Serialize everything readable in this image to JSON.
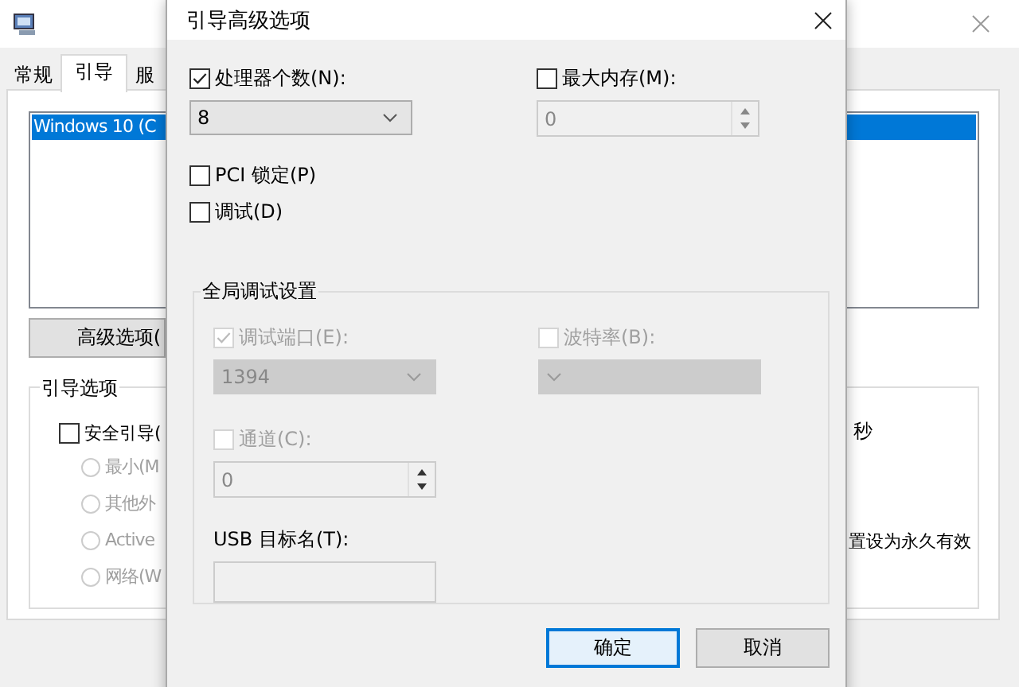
{
  "main_window": {
    "tabs": [
      {
        "label": "常规",
        "selected": false
      },
      {
        "label": "引导",
        "selected": true
      },
      {
        "label": "服",
        "selected": false
      }
    ],
    "boot_list": [
      {
        "label": "Windows 10 (C",
        "selected": true
      }
    ],
    "advanced_button": "高级选项(",
    "boot_options": {
      "title": "引导选项",
      "safe_boot": {
        "label": "安全引导(",
        "checked": false
      },
      "modes": [
        {
          "label": "最小(M",
          "selected": false,
          "disabled": true
        },
        {
          "label": "其他外",
          "selected": false,
          "disabled": true
        },
        {
          "label": "Active",
          "selected": false,
          "disabled": true
        },
        {
          "label": "网络(W",
          "selected": false,
          "disabled": true
        }
      ]
    },
    "timeout_unit": "秒",
    "permanent_note": "置设为永久有效"
  },
  "dialog": {
    "title": "引导高级选项",
    "processors": {
      "label": "处理器个数(N):",
      "checked": true,
      "disabled": false,
      "value": "8"
    },
    "max_memory": {
      "label": "最大内存(M):",
      "checked": false,
      "disabled": false,
      "value": "0",
      "field_disabled": true
    },
    "pci_lock": {
      "label": "PCI 锁定(P)",
      "checked": false
    },
    "debug": {
      "label": "调试(D)",
      "checked": false
    },
    "debug_settings": {
      "title": "全局调试设置",
      "port": {
        "label": "调试端口(E):",
        "checked": true,
        "disabled": true,
        "value": "1394"
      },
      "baud": {
        "label": "波特率(B):",
        "checked": false,
        "disabled": true
      },
      "channel": {
        "label": "通道(C):",
        "checked": false,
        "disabled": true,
        "value": "0"
      },
      "usb_target": {
        "label": "USB 目标名(T):"
      }
    },
    "buttons": [
      {
        "label": "确定",
        "default": true
      },
      {
        "label": "取消",
        "default": false
      }
    ]
  }
}
